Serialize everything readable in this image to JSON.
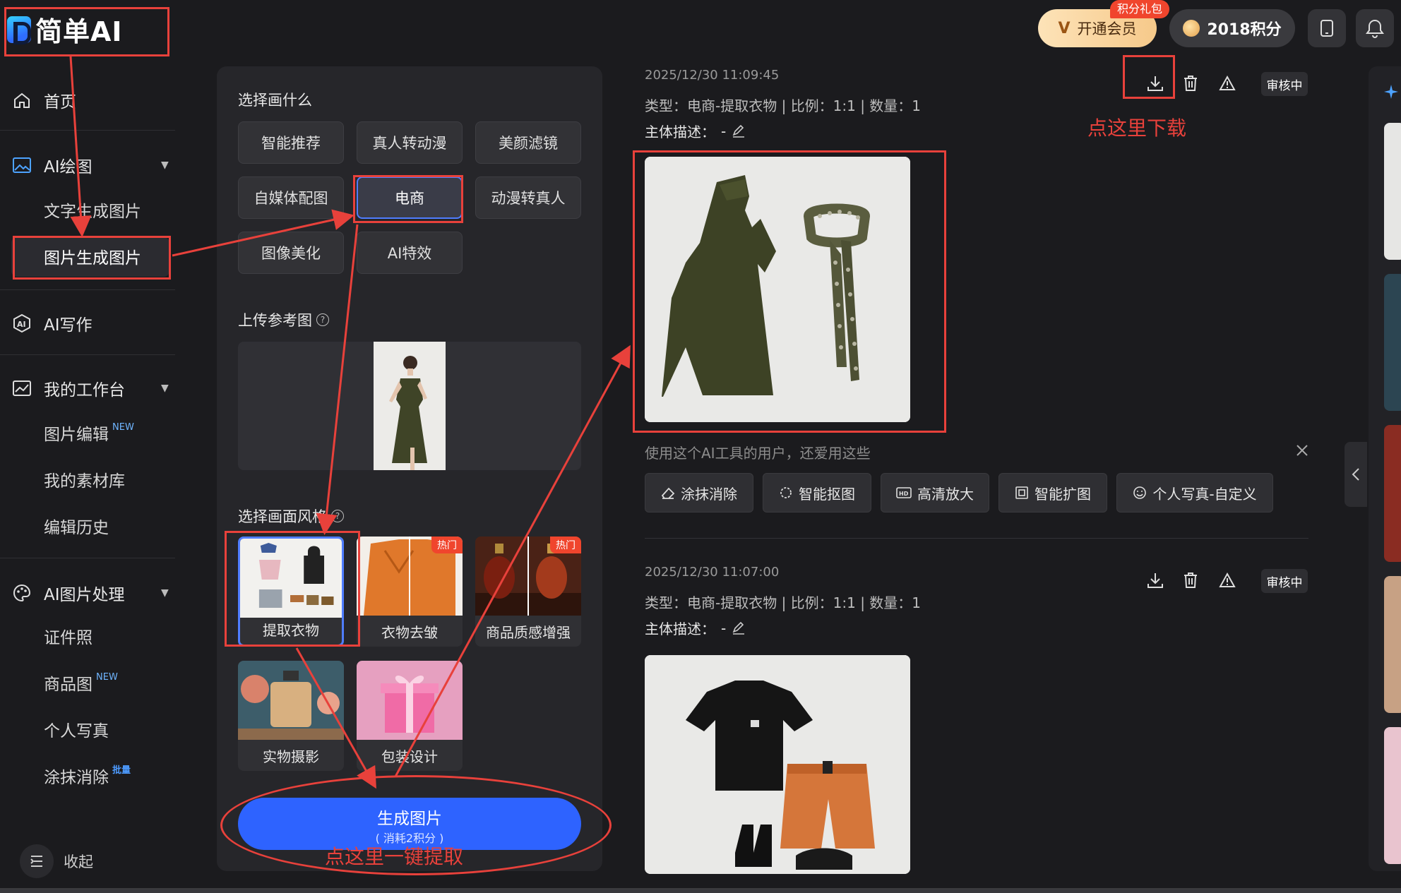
{
  "app": {
    "logo_text": "简单AI"
  },
  "header": {
    "vip_label": "开通会员",
    "vip_badge": "积分礼包",
    "points": "2018积分"
  },
  "sidebar": {
    "home": "首页",
    "ai_drawing": "AI绘图",
    "text_to_image": "文字生成图片",
    "image_to_image": "图片生成图片",
    "ai_writing": "AI写作",
    "workbench": "我的工作台",
    "image_edit": "图片编辑",
    "image_edit_badge": "NEW",
    "assets": "我的素材库",
    "history": "编辑历史",
    "ai_image_process": "AI图片处理",
    "id_photo": "证件照",
    "product_image": "商品图",
    "product_image_badge": "NEW",
    "portrait": "个人写真",
    "erase": "涂抹消除",
    "erase_badge": "批量",
    "collapse": "收起"
  },
  "panel": {
    "choose_title": "选择画什么",
    "categories": [
      "智能推荐",
      "真人转动漫",
      "美颜滤镜",
      "自媒体配图",
      "电商",
      "动漫转真人",
      "图像美化",
      "AI特效"
    ],
    "upload_title": "上传参考图",
    "style_title": "选择画面风格",
    "styles": [
      {
        "label": "提取衣物",
        "hot": ""
      },
      {
        "label": "衣物去皱",
        "hot": "热门"
      },
      {
        "label": "商品质感增强",
        "hot": "热门"
      },
      {
        "label": "实物摄影",
        "hot": ""
      },
      {
        "label": "包装设计",
        "hot": ""
      }
    ],
    "generate_label": "生成图片",
    "generate_cost": "( 消耗2积分 )"
  },
  "results": [
    {
      "time": "2025/12/30 11:09:45",
      "meta": "类型：电商-提取衣物 | 比例：1:1 | 数量：1",
      "desc_label": "主体描述：",
      "desc_value": "-",
      "status": "审核中"
    },
    {
      "time": "2025/12/30 11:07:00",
      "meta": "类型：电商-提取衣物 | 比例：1:1 | 数量：1",
      "desc_label": "主体描述：",
      "desc_value": "-",
      "status": "审核中"
    }
  ],
  "recommend": {
    "title": "使用这个AI工具的用户，还爱用这些",
    "tools": [
      "涂抹消除",
      "智能抠图",
      "高清放大",
      "智能扩图",
      "个人写真-自定义"
    ]
  },
  "annotations": {
    "download_hint": "点这里下载",
    "extract_hint": "点这里一键提取"
  },
  "colors": {
    "accent": "#2e63ff",
    "annotation": "#e8413b",
    "background": "#1b1b1e"
  }
}
